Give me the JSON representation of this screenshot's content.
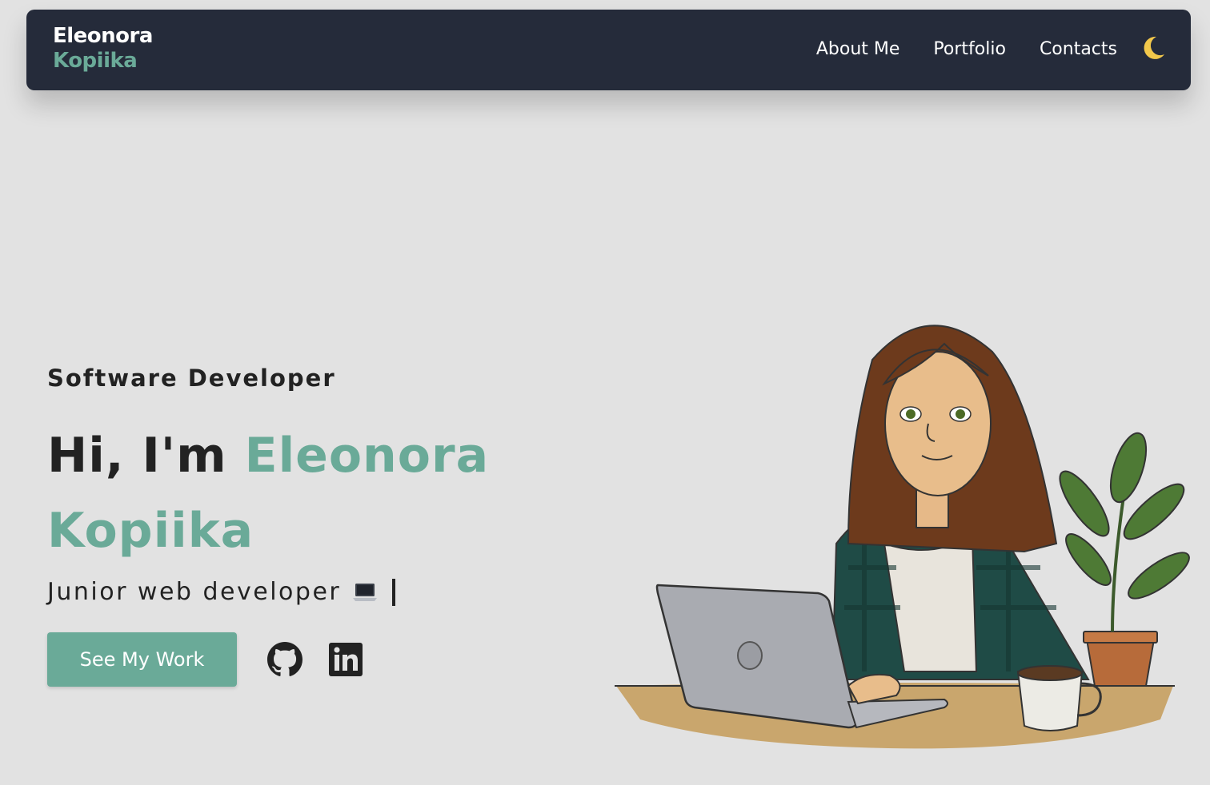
{
  "navbar": {
    "brand_first": "Eleonora",
    "brand_last": "Kopiika",
    "links": [
      {
        "label": "About Me"
      },
      {
        "label": "Portfolio"
      },
      {
        "label": "Contacts"
      }
    ],
    "theme_icon": "moon-icon"
  },
  "hero": {
    "eyebrow": "Software Developer",
    "greeting": "Hi, I'm ",
    "name_first": "Eleonora",
    "name_last": "Kopiika",
    "tagline": "Junior web developer",
    "tagline_emoji_icon": "laptop-icon",
    "cta_label": "See My Work",
    "socials": [
      {
        "icon": "github-icon"
      },
      {
        "icon": "linkedin-icon"
      }
    ]
  },
  "colors": {
    "background": "#e2e2e2",
    "navbar": "#252b3a",
    "accent": "#6aaa98",
    "moon": "#f2c84b",
    "text": "#222222"
  }
}
